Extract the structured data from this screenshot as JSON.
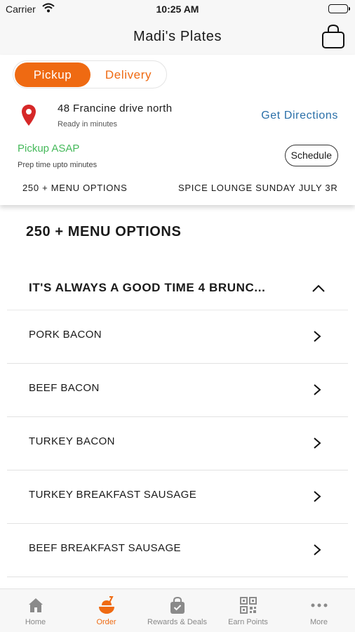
{
  "status_bar": {
    "carrier": "Carrier",
    "time": "10:25 AM"
  },
  "header": {
    "title": "Madi's Plates"
  },
  "order_mode": {
    "options": [
      "Pickup",
      "Delivery"
    ],
    "selected": "Pickup"
  },
  "location": {
    "address": "48 Francine drive north",
    "ready_text": "Ready in minutes",
    "directions_label": "Get Directions"
  },
  "pickup": {
    "status": "Pickup ASAP",
    "prep_text": "Prep time upto minutes",
    "schedule_label": "Schedule"
  },
  "category_tabs": [
    "250 + MENU OPTIONS",
    "SPICE LOUNGE SUNDAY JULY 3R"
  ],
  "menu": {
    "section_title": "250 + MENU OPTIONS",
    "group_title": "IT'S ALWAYS A GOOD TIME 4 BRUNC...",
    "items": [
      "PORK BACON",
      "BEEF BACON",
      "TURKEY BACON",
      "TURKEY BREAKFAST SAUSAGE",
      "BEEF BREAKFAST SAUSAGE"
    ]
  },
  "tab_bar": {
    "items": [
      {
        "label": "Home",
        "icon": "home-icon"
      },
      {
        "label": "Order",
        "icon": "order-icon"
      },
      {
        "label": "Rewards & Deals",
        "icon": "rewards-bag-icon"
      },
      {
        "label": "Earn Points",
        "icon": "qr-code-icon"
      },
      {
        "label": "More",
        "icon": "more-dots-icon"
      }
    ],
    "active": "Order"
  },
  "colors": {
    "accent": "#ef6a12",
    "link": "#2a6fa8",
    "success": "#45b95a",
    "pin": "#d62828"
  }
}
